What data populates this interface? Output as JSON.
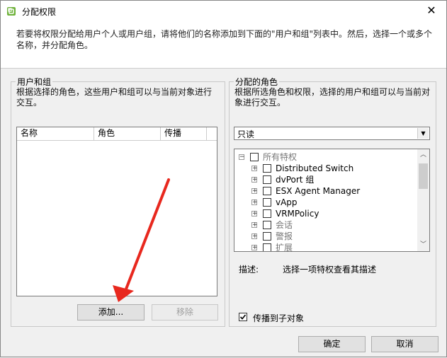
{
  "window": {
    "title": "分配权限",
    "close_label": "✕"
  },
  "intro_text": "若要将权限分配给用户个人或用户组，请将他们的名称添加到下面的\"用户和组\"列表中。然后，选择一个或多个名称，并分配角色。",
  "users_groups": {
    "label": "用户和组",
    "description": "根据选择的角色，这些用户和组可以与当前对象进行交互。",
    "columns": [
      "名称",
      "角色",
      "传播"
    ],
    "add_button": "添加...",
    "remove_button": "移除"
  },
  "assigned_role": {
    "label": "分配的角色",
    "description": "根据所选角色和权限，选择的用户和组可以与当前对象进行交互。",
    "role_selected": "只读",
    "tree": [
      {
        "label": "所有特权",
        "level": 0,
        "gray": true,
        "expander": "−"
      },
      {
        "label": "Distributed Switch",
        "level": 1,
        "gray": false,
        "expander": "+"
      },
      {
        "label": "dvPort 组",
        "level": 1,
        "gray": false,
        "expander": "+"
      },
      {
        "label": "ESX Agent Manager",
        "level": 1,
        "gray": false,
        "expander": "+"
      },
      {
        "label": "vApp",
        "level": 1,
        "gray": false,
        "expander": "+"
      },
      {
        "label": "VRMPolicy",
        "level": 1,
        "gray": false,
        "expander": "+"
      },
      {
        "label": "会话",
        "level": 1,
        "gray": true,
        "expander": "+"
      },
      {
        "label": "警报",
        "level": 1,
        "gray": true,
        "expander": "+"
      },
      {
        "label": "扩展",
        "level": 1,
        "gray": true,
        "expander": "+"
      }
    ],
    "description_label": "描述:",
    "description_value": "选择一项特权查看其描述",
    "propagate_label": "传播到子对象",
    "propagate_checked": true
  },
  "footer": {
    "ok_button": "确定",
    "cancel_button": "取消"
  },
  "annotation": {
    "arrow_color": "#e8281e"
  }
}
